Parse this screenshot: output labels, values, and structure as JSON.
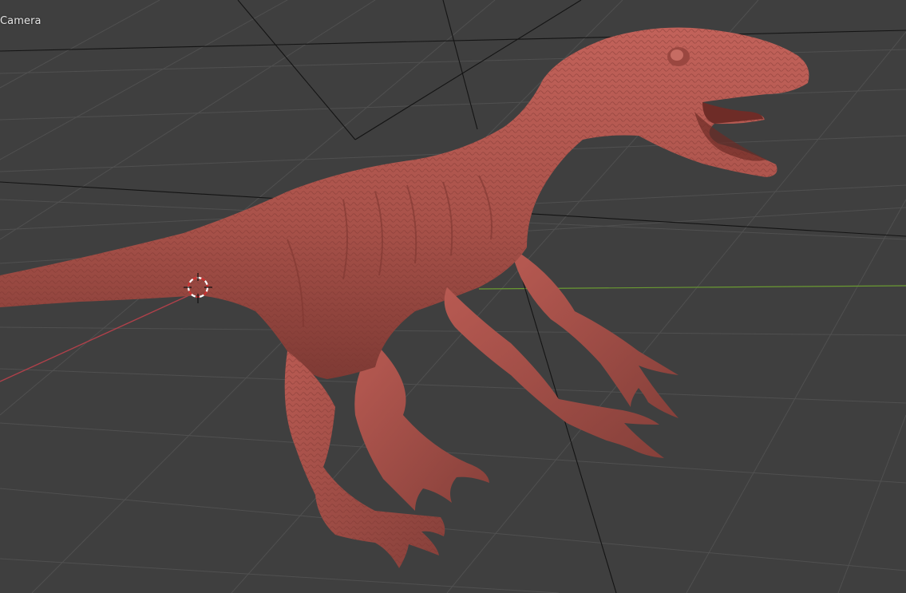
{
  "viewport": {
    "view_name": "Camera",
    "background": "#3f3f3f",
    "grid_color": "#4e4e4e",
    "x_axis_color": "#b0404a",
    "y_axis_color": "#6a9a32",
    "camera_frame_color": "#111111",
    "model_color": "#b4564e",
    "cursor_icon": "3d-cursor-icon"
  }
}
